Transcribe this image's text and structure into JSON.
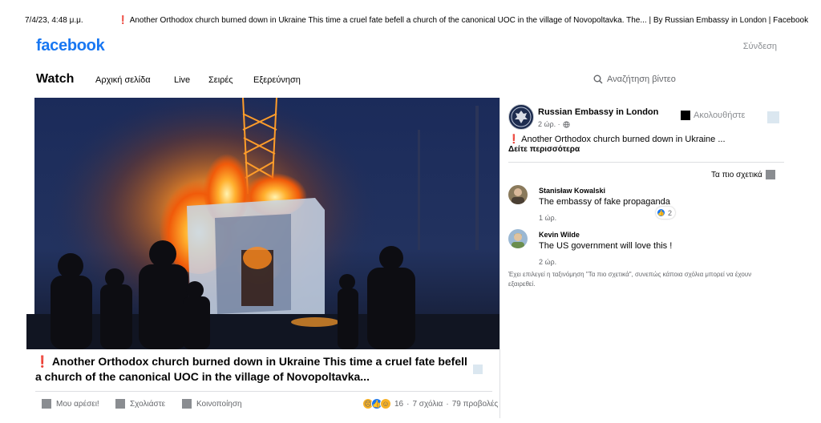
{
  "print_header": {
    "date": "7/4/23, 4:48 μ.μ.",
    "page_title": "Another Orthodox church burned down in Ukraine This time a cruel fate befell a church of the canonical UOC in the village of Novopoltavka. The... | By Russian Embassy in London | Facebook",
    "exclamation": "❗"
  },
  "header": {
    "logo": "facebook",
    "login_label": "Σύνδεση"
  },
  "nav": {
    "watch_label": "Watch",
    "items": [
      "Αρχική σελίδα",
      "Live",
      "Σειρές",
      "Εξερεύνηση"
    ],
    "search_placeholder": "Αναζήτηση βίντεο",
    "search_icon": "search-icon"
  },
  "video": {
    "title_exclamation": "❗",
    "title": "Another Orthodox church burned down in Ukraine This time a cruel fate befell a church of the canonical UOC in the village of Novopoltavka...",
    "actions": {
      "like": "Μου αρέσει!",
      "comment": "Σχολιάστε",
      "share": "Κοινοποίηση"
    },
    "stats": {
      "reactions_count": "16",
      "separator": "·",
      "comments": "7 σχόλια",
      "views": "79 προβολές"
    }
  },
  "post": {
    "page_name": "Russian Embassy in London",
    "time": "2 ώρ. ·",
    "follow_label": "Ακολουθήστε",
    "text_exclamation": "❗",
    "text": "Another Orthodox church burned down in Ukraine ...",
    "see_more": "Δείτε περισσότερα"
  },
  "comments_section": {
    "sort_label": "Τα πιο σχετικά",
    "comments": [
      {
        "author": "Stanisław Kowalski",
        "text": "The embassy of fake propaganda",
        "time": "1 ώρ.",
        "reaction_count": "2"
      },
      {
        "author": "Kevin Wilde",
        "text": "The US government will love this !",
        "time": "2 ώρ."
      }
    ],
    "footnote": "Έχει επιλεγεί η ταξινόμηση \"Τα πιο σχετικά\", συνεπώς κάποια σχόλια μπορεί να έχουν εξαιρεθεί."
  },
  "colors": {
    "brand_blue": "#1877f2",
    "alert_red": "#e41e3f",
    "muted_text": "#65676b"
  }
}
